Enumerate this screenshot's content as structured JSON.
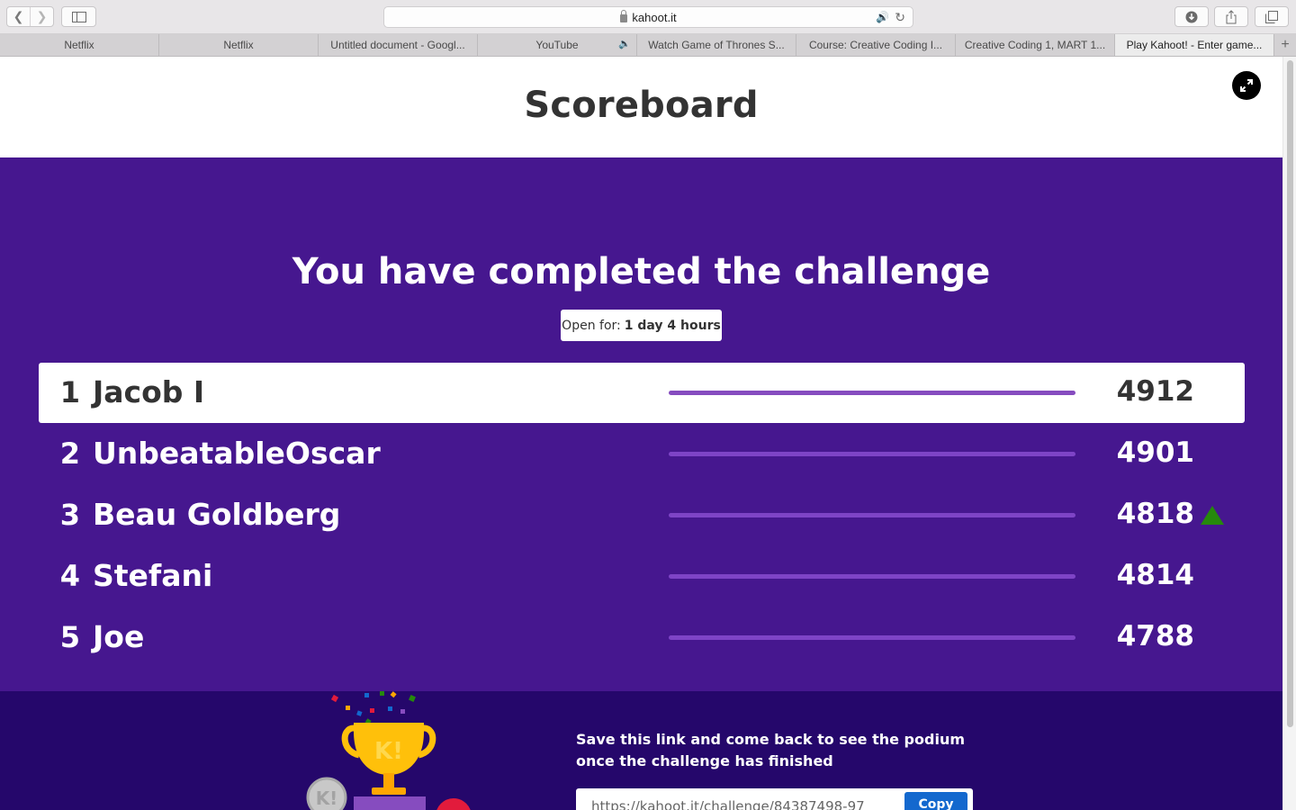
{
  "browser": {
    "url": "kahoot.it",
    "tabs": [
      {
        "label": "Netflix",
        "active": false,
        "audio": false
      },
      {
        "label": "Netflix",
        "active": false,
        "audio": false
      },
      {
        "label": "Untitled document - Googl...",
        "active": false,
        "audio": false
      },
      {
        "label": "YouTube",
        "active": false,
        "audio": true
      },
      {
        "label": "Watch Game of Thrones S...",
        "active": false,
        "audio": false
      },
      {
        "label": "Course: Creative Coding I...",
        "active": false,
        "audio": false
      },
      {
        "label": "Creative Coding 1, MART 1...",
        "active": false,
        "audio": false
      },
      {
        "label": "Play Kahoot! - Enter game...",
        "active": true,
        "audio": false
      }
    ],
    "new_tab_symbol": "+"
  },
  "header": {
    "title": "Scoreboard"
  },
  "challenge": {
    "heading": "You have completed the challenge",
    "open_for_label": "Open for:",
    "open_for_value": "1 day 4 hours"
  },
  "leaderboard": [
    {
      "rank": "1",
      "name": "Jacob I",
      "score": "4912",
      "progress": 1.0,
      "highlight": true,
      "trend": ""
    },
    {
      "rank": "2",
      "name": "UnbeatableOscar",
      "score": "4901",
      "progress": 1.0,
      "highlight": false,
      "trend": ""
    },
    {
      "rank": "3",
      "name": "Beau Goldberg",
      "score": "4818",
      "progress": 1.0,
      "highlight": false,
      "trend": "up"
    },
    {
      "rank": "4",
      "name": "Stefani",
      "score": "4814",
      "progress": 1.0,
      "highlight": false,
      "trend": ""
    },
    {
      "rank": "5",
      "name": "Joe",
      "score": "4788",
      "progress": 1.0,
      "highlight": false,
      "trend": ""
    }
  ],
  "footer": {
    "save_text": "Save this link and come back to see the podium once the challenge has finished",
    "link_value": "https://kahoot.it/challenge/84387498-97",
    "copy_label": "Copy",
    "trophy_letters": "K!"
  },
  "colors": {
    "brand_purple": "#46178f",
    "footer_purple": "#25076b",
    "bar_purple": "#864cbf",
    "trend_up": "#26890c",
    "copy_blue": "#1368ce"
  },
  "icons": [
    "back-icon",
    "forward-icon",
    "sidebar-icon",
    "lock-icon",
    "speaker-icon",
    "reload-icon",
    "download-icon",
    "share-icon",
    "tabs-icon",
    "fullscreen-icon",
    "trend-up-icon",
    "trophy-icon"
  ]
}
